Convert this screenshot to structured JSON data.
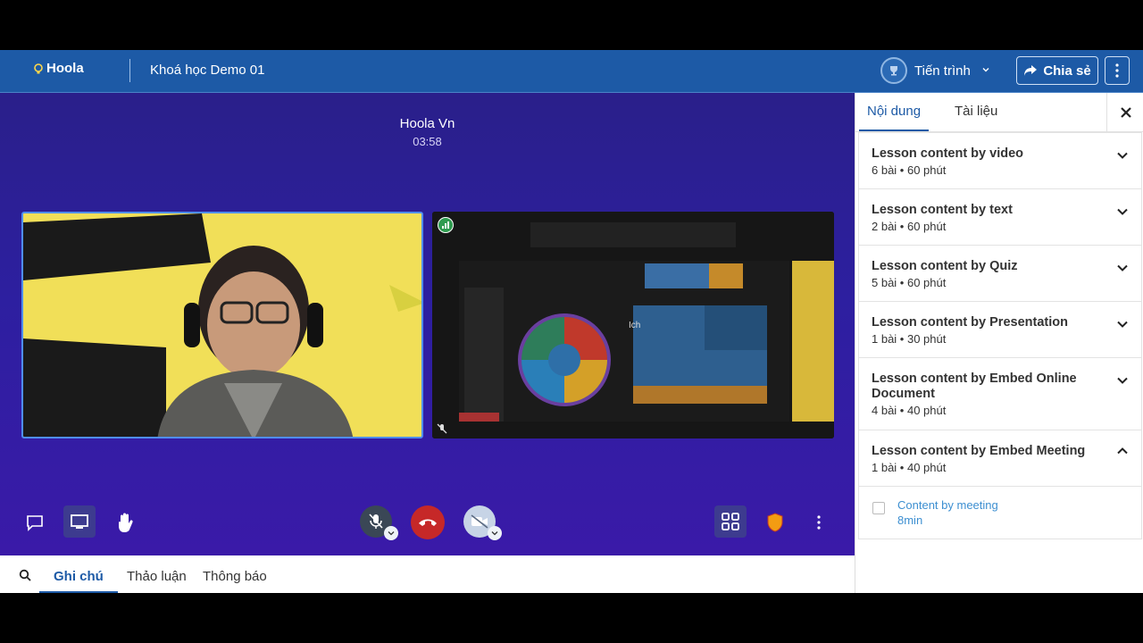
{
  "header": {
    "logo_text": "Hoola",
    "course_title": "Khoá học Demo 01",
    "progress_label": "Tiến trình",
    "share_label": "Chia sẻ"
  },
  "stage": {
    "host_name": "Hoola Vn",
    "timer": "03:58",
    "screen_share_caption": "Ich"
  },
  "sidebar": {
    "tabs": [
      "Nội dung",
      "Tài liệu"
    ],
    "active_tab": "Nội dung",
    "sections": [
      {
        "title": "Lesson content by video",
        "meta": "6 bài • 60 phút",
        "expanded": false
      },
      {
        "title": "Lesson content by text",
        "meta": "2 bài • 60 phút",
        "expanded": false
      },
      {
        "title": "Lesson content by Quiz",
        "meta": "5 bài • 60 phút",
        "expanded": false
      },
      {
        "title": "Lesson content by Presentation",
        "meta": "1 bài • 30 phút",
        "expanded": false
      },
      {
        "title": "Lesson content by Embed Online Document",
        "meta": "4 bài • 40 phút",
        "expanded": false
      },
      {
        "title": "Lesson content by Embed Meeting",
        "meta": "1 bài • 40 phút",
        "expanded": true
      }
    ],
    "lesson_items": [
      {
        "name": "Content by meeting",
        "duration": "8min",
        "checked": false
      }
    ]
  },
  "bottom_tabs": {
    "items": [
      "Ghi chú",
      "Thảo luận",
      "Thông báo"
    ],
    "active": "Ghi chú"
  },
  "colors": {
    "header_bg": "#1d5aa6",
    "stage_bg": "#2d1fa0",
    "end_call": "#c62828",
    "accent": "#1d5aa6",
    "lesson_link": "#3d8fd1"
  }
}
